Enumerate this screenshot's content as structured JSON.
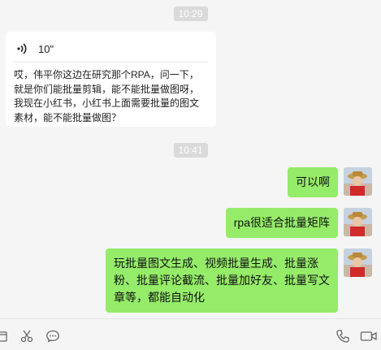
{
  "messages": {
    "time1": "10:29",
    "voice_duration": "10\"",
    "voice_transcript": "哎，伟平你这边在研究那个RPA，问一下，就是你们能批量剪辑，能不能批量做图呀，我现在小红书，小红书上面需要批量的图文素材，能不能批量做图？",
    "time2": "10:41",
    "reply1": "可以啊",
    "reply2": "rpa很适合批量矩阵",
    "reply3": "玩批量图文生成、视频批量生成、批量涨粉、批量评论截流、批量加好友、批量写文章等，都能自动化"
  },
  "colors": {
    "bubble_green": "#95ec69",
    "chat_bg": "#f5f5f5",
    "time_pill": "#dadada"
  },
  "toolbar": {
    "icons": [
      "folder-icon",
      "scissors-icon",
      "chat-icon",
      "phone-icon",
      "video-call-icon"
    ]
  }
}
